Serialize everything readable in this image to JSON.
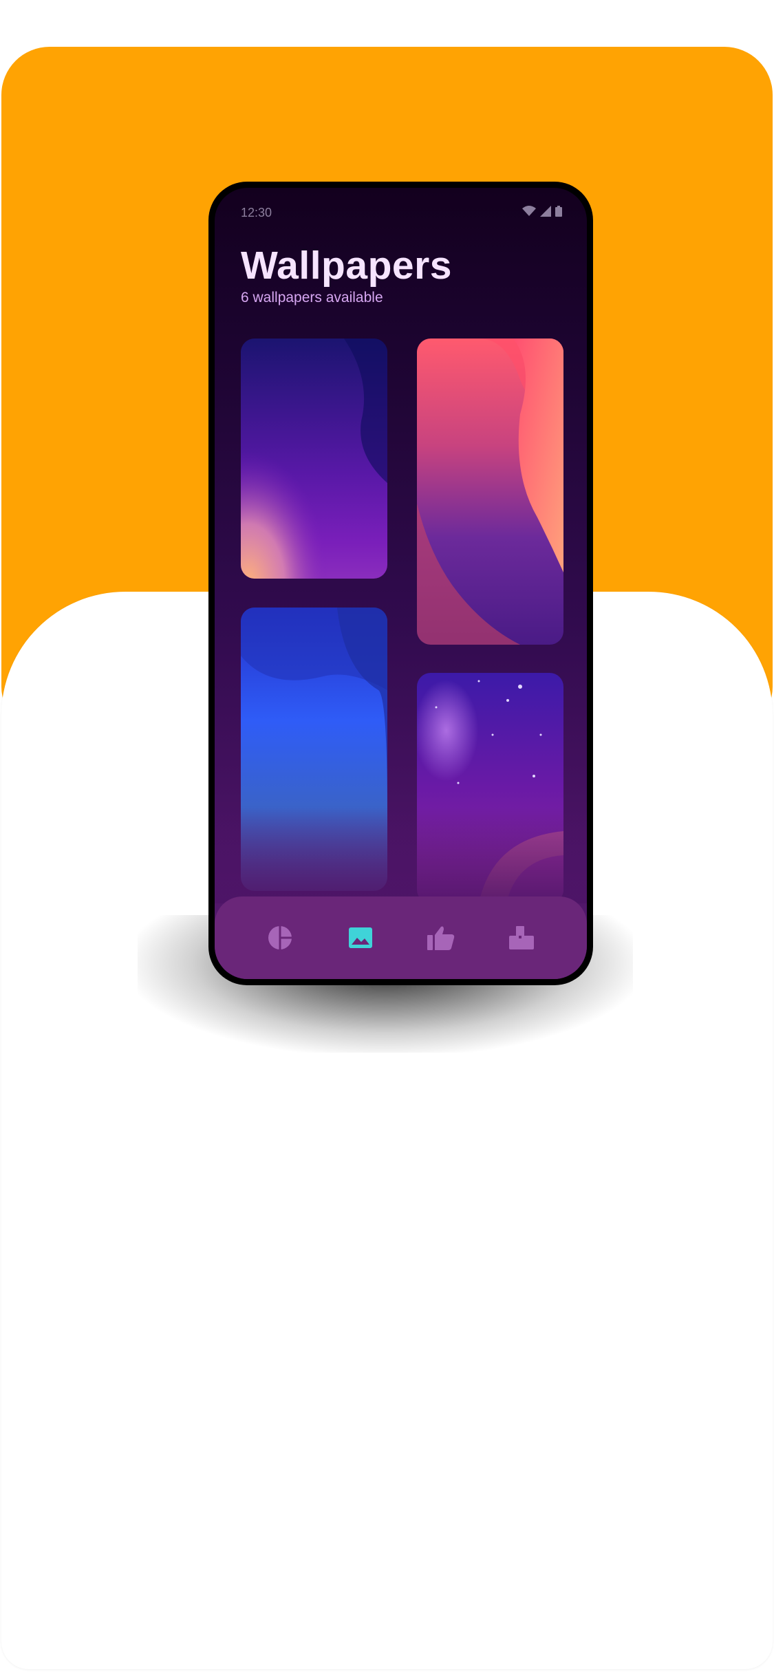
{
  "status_bar": {
    "time": "12:30",
    "icons": [
      "wifi-icon",
      "signal-icon",
      "battery-icon"
    ]
  },
  "header": {
    "title": "Wallpapers",
    "subtitle": "6 wallpapers available"
  },
  "wallpapers": [
    {
      "name": "purple-dusk"
    },
    {
      "name": "coral-waves"
    },
    {
      "name": "blue-waves"
    },
    {
      "name": "galaxy"
    }
  ],
  "bottom_nav": {
    "items": [
      {
        "icon": "dashboard-icon",
        "active": false,
        "color": "#a765b8"
      },
      {
        "icon": "wallpaper-icon",
        "active": true,
        "color": "#3fd3d8"
      },
      {
        "icon": "thumbs-up-icon",
        "active": false,
        "color": "#a765b8"
      },
      {
        "icon": "submit-icon",
        "active": false,
        "color": "#a765b8"
      }
    ]
  },
  "colors": {
    "backdrop_accent": "#ffa303",
    "title": "#f6e4ff",
    "subtitle": "#d7a7f2",
    "nav_background": "#6a2679"
  }
}
